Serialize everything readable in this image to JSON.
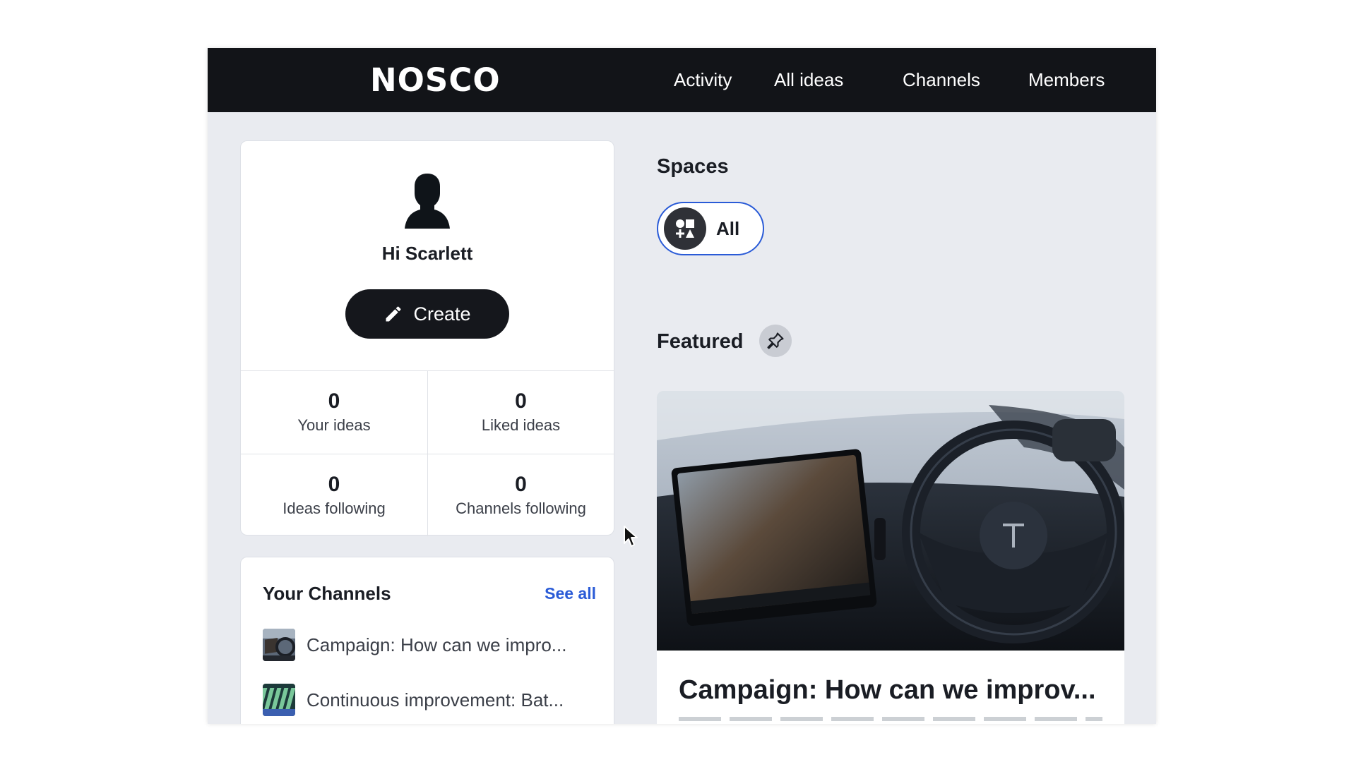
{
  "app": {
    "logo": "NOSCO"
  },
  "nav": {
    "items": [
      {
        "label": "Activity"
      },
      {
        "label": "All ideas"
      },
      {
        "label": "Channels"
      },
      {
        "label": "Members"
      }
    ]
  },
  "profile": {
    "greeting": "Hi Scarlett",
    "create_label": "Create",
    "stats": [
      {
        "value": "0",
        "label": "Your ideas"
      },
      {
        "value": "0",
        "label": "Liked ideas"
      },
      {
        "value": "0",
        "label": "Ideas following"
      },
      {
        "value": "0",
        "label": "Channels following"
      }
    ]
  },
  "channels": {
    "title": "Your Channels",
    "see_all": "See all",
    "items": [
      {
        "label": "Campaign: How can we impro...",
        "icon": "car-interior-thumbnail"
      },
      {
        "label": "Continuous improvement: Bat...",
        "icon": "battery-cells-thumbnail"
      }
    ]
  },
  "spaces": {
    "title": "Spaces",
    "all_label": "All",
    "icon": "shapes-icon"
  },
  "featured": {
    "title": "Featured",
    "pin_icon": "pin-icon",
    "card_title": "Campaign: How can we improv..."
  },
  "colors": {
    "nav_bg": "#121418",
    "page_bg": "#e9ebf0",
    "accent": "#2a5bd7"
  }
}
